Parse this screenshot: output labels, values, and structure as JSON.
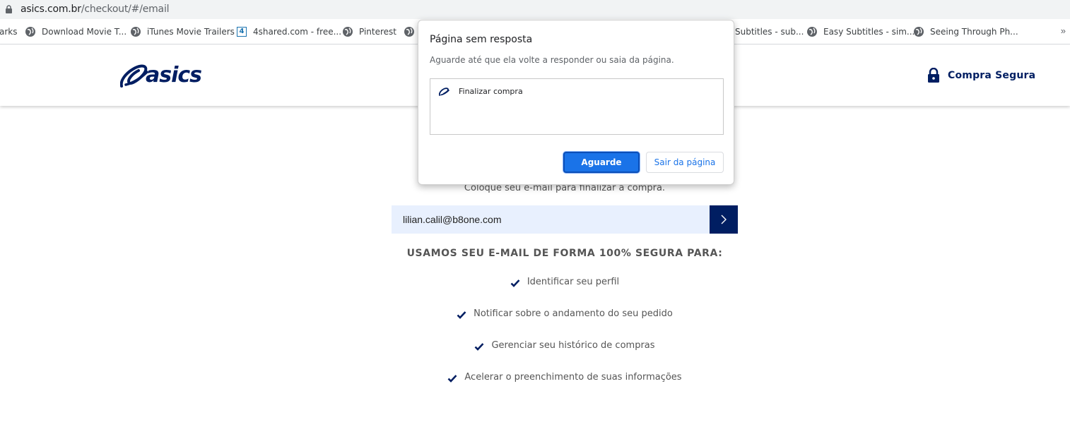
{
  "browser": {
    "url_host": "asics.com.br",
    "url_path": "/checkout/#/email",
    "bookmarks": [
      {
        "label": "arks",
        "icon": "none"
      },
      {
        "label": "Download Movie T...",
        "icon": "globe-icon"
      },
      {
        "label": "iTunes Movie Trailers",
        "icon": "globe-icon"
      },
      {
        "label": "4shared.com - free...",
        "icon": "4shared-icon"
      },
      {
        "label": "Pinterest",
        "icon": "globe-icon"
      },
      {
        "label": "",
        "icon": "globe-icon"
      },
      {
        "label": "Subtitles - sub...",
        "icon": "none"
      },
      {
        "label": "Easy Subtitles - sim...",
        "icon": "globe-icon"
      },
      {
        "label": "Seeing Through Ph...",
        "icon": "globe-icon"
      }
    ],
    "more_bookmarks": "»"
  },
  "header": {
    "brand": "asics",
    "secure_label": "Compra Segura",
    "brand_color": "#001e62"
  },
  "main": {
    "subtitle": "Coloque seu e-mail para finalizar a compra.",
    "email_value": "lilian.calil@b8one.com",
    "secure_title": "USAMOS SEU E-MAIL DE FORMA 100% SEGURA PARA:",
    "benefits": [
      "Identificar seu perfil",
      "Notificar sobre o andamento do seu pedido",
      "Gerenciar seu histórico de compras",
      "Acelerar o preenchimento de suas informações"
    ]
  },
  "dialog": {
    "title": "Página sem resposta",
    "message": "Aguarde até que ela volte a responder ou saia da página.",
    "page_item": "Finalizar compra",
    "wait_button": "Aguarde",
    "leave_button": "Sair da página",
    "accent_color": "#1a73e8"
  }
}
